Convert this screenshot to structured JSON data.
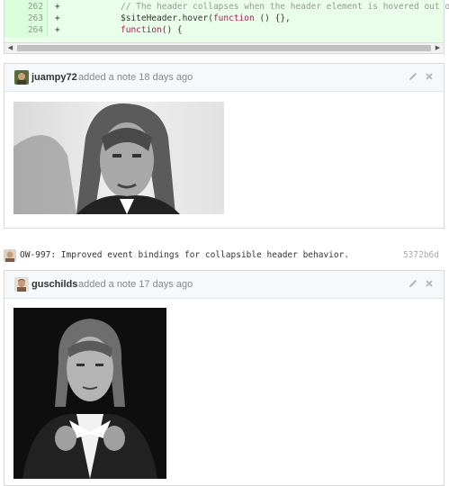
{
  "diff": {
    "lines": [
      {
        "num": "262",
        "sign": "+",
        "code": "// The header collapses when the header element is hovered out of."
      },
      {
        "num": "263",
        "sign": "+",
        "code_a": "$siteHeader.hover(",
        "code_kw": "function",
        "code_b": " () {},"
      },
      {
        "num": "264",
        "sign": "+",
        "code_kw": "function",
        "code_b": "() {"
      }
    ]
  },
  "notes": [
    {
      "author": "juampy72",
      "meta": "added a note 18 days ago"
    },
    {
      "author": "guschilds",
      "meta": "added a note 17 days ago"
    }
  ],
  "commit": {
    "message": "OW-997: Improved event bindings for collapsible header behavior.",
    "sha": "5372b6d"
  },
  "icons": {
    "edit": "pencil-icon",
    "delete": "close-icon",
    "scroll_left": "chevron-left-icon",
    "scroll_right": "chevron-right-icon"
  },
  "colors": {
    "diff_bg": "#eaffea",
    "note_header_bg": "#f5f9fb",
    "author": "#333333",
    "meta": "#888888"
  }
}
